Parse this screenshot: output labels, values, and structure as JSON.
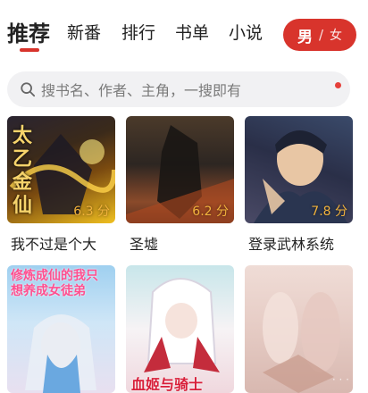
{
  "tabs": [
    {
      "label": "推荐",
      "active": true
    },
    {
      "label": "新番"
    },
    {
      "label": "排行"
    },
    {
      "label": "书单"
    },
    {
      "label": "小说"
    }
  ],
  "gender": {
    "male": "男",
    "separator": "/",
    "female": "女"
  },
  "search": {
    "placeholder": "搜书名、作者、主角，一搜即有"
  },
  "accent_color": "#d8342c",
  "score_color": "#f1b23c",
  "books": [
    {
      "title": "我不过是个大",
      "score": "6.3 分",
      "cover_text": "太乙金仙"
    },
    {
      "title": "圣墟",
      "score": "6.2 分"
    },
    {
      "title": "登录武林系统",
      "score": "7.8 分"
    },
    {
      "title": "",
      "score": "",
      "cover_text": "修炼成仙的我只想养成女徒弟"
    },
    {
      "title": "",
      "score": "",
      "cover_text": "血姬与骑士"
    },
    {
      "title": "",
      "score": ""
    }
  ]
}
